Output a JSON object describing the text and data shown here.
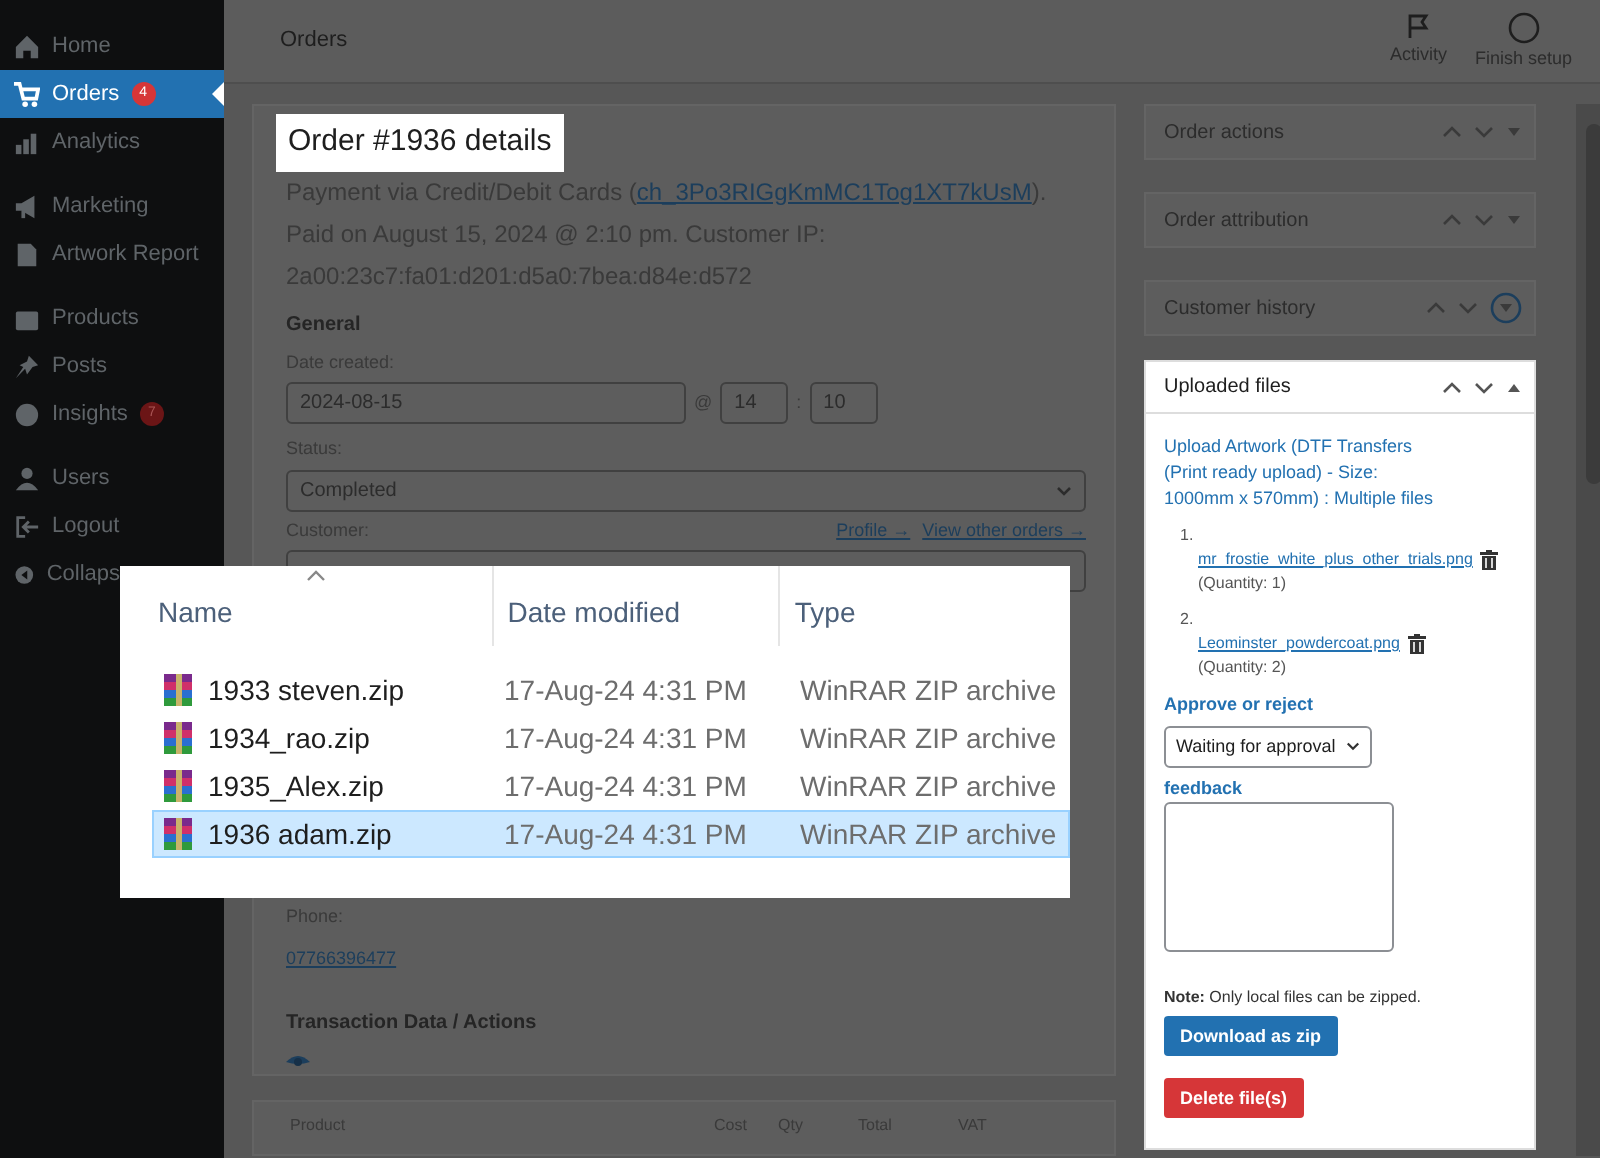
{
  "sidebar": {
    "items": [
      {
        "label": "Home",
        "selected": false
      },
      {
        "label": "Orders",
        "selected": true,
        "badge": "4"
      },
      {
        "label": "Analytics",
        "selected": false
      },
      {
        "label": "Marketing",
        "selected": false
      },
      {
        "label": "Artwork Report",
        "selected": false
      },
      {
        "label": "Products",
        "selected": false
      },
      {
        "label": "Posts",
        "selected": false
      },
      {
        "label": "Insights",
        "selected": false,
        "badge": "7"
      },
      {
        "label": "Users",
        "selected": false
      },
      {
        "label": "Logout",
        "selected": false
      },
      {
        "label": "Collaps",
        "selected": false
      }
    ]
  },
  "topbar": {
    "title": "Orders",
    "actions": [
      {
        "label": "Activity"
      },
      {
        "label": "Finish setup"
      }
    ]
  },
  "order": {
    "title": "Order #1936 details",
    "payment_before": "Payment via Credit/Debit Cards (",
    "payment_link": "ch_3Po3RIGgKmMC1Tog1XT7kUsM",
    "payment_after": "). Paid on August 15, 2024 @ 2:10 pm. Customer IP: 2a00:23c7:fa01:d201:d5a0:7bea:d84e:d572",
    "general": "General",
    "date_label": "Date created:",
    "date": "2024-08-15",
    "at": "@",
    "hour": "14",
    "sep": ":",
    "minute": "10",
    "status_label": "Status:",
    "status": "Completed",
    "customer_label": "Customer:",
    "profile_link": "Profile →",
    "orders_link": "View other orders →",
    "phone_label": "Phone:",
    "phone": "07766396477",
    "transaction": "Transaction Data / Actions"
  },
  "items_table": {
    "columns": [
      "Product",
      "Cost",
      "Qty",
      "Total",
      "VAT"
    ]
  },
  "boxes": [
    {
      "title": "Order actions",
      "expanded": false,
      "focused": false
    },
    {
      "title": "Order attribution",
      "expanded": false,
      "focused": false
    },
    {
      "title": "Customer history",
      "expanded": false,
      "focused": true
    }
  ],
  "uploads": {
    "title": "Uploaded files",
    "expanded": true,
    "heading": "Upload Artwork (DTF Transfers (Print ready upload) - Size: 1000mm x 570mm) : Multiple files",
    "files": [
      {
        "number": "1.",
        "name": "mr_frostie_white_plus_other_trials.png",
        "quantity": "(Quantity: 1)"
      },
      {
        "number": "2.",
        "name": "Leominster_powdercoat.png",
        "quantity": "(Quantity: 2)"
      }
    ],
    "approve_label": "Approve or reject",
    "approve_value": "Waiting for approval",
    "feedback_label": "feedback",
    "note_bold": "Note:",
    "note": "Only local files can be zipped.",
    "download": "Download as zip",
    "delete": "Delete file(s)"
  },
  "explorer": {
    "columns": [
      {
        "label": "Name",
        "sorted": true
      },
      {
        "label": "Date modified",
        "sorted": false
      },
      {
        "label": "Type",
        "sorted": false
      }
    ],
    "rows": [
      {
        "name": "1933 steven.zip",
        "date": "17-Aug-24 4:31 PM",
        "type": "WinRAR ZIP archive",
        "selected": false
      },
      {
        "name": "1934_rao.zip",
        "date": "17-Aug-24 4:31 PM",
        "type": "WinRAR ZIP archive",
        "selected": false
      },
      {
        "name": "1935_Alex.zip",
        "date": "17-Aug-24 4:31 PM",
        "type": "WinRAR ZIP archive",
        "selected": false
      },
      {
        "name": "1936 adam.zip",
        "date": "17-Aug-24 4:31 PM",
        "type": "WinRAR ZIP archive",
        "selected": true
      }
    ]
  }
}
